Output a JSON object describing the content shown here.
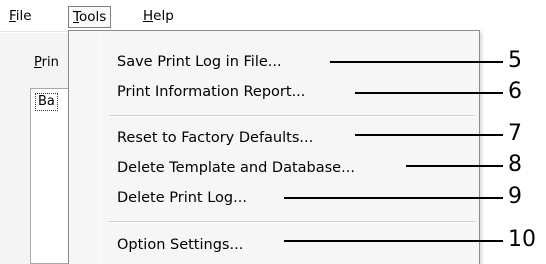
{
  "menubar": {
    "file_label": "File",
    "tools_label": "Tools",
    "help_label": "Help"
  },
  "background": {
    "label_text": "Prin",
    "field_label": "Ba"
  },
  "tools_menu": {
    "items": [
      {
        "label": "Save Print Log in File...",
        "callout": "5"
      },
      {
        "label": "Print Information Report...",
        "callout": "6"
      },
      {
        "label": "Reset to Factory Defaults...",
        "callout": "7"
      },
      {
        "label": "Delete Template and Database...",
        "callout": "8"
      },
      {
        "label": "Delete Print Log...",
        "callout": "9"
      },
      {
        "label": "Option Settings...",
        "callout": "10"
      }
    ]
  }
}
